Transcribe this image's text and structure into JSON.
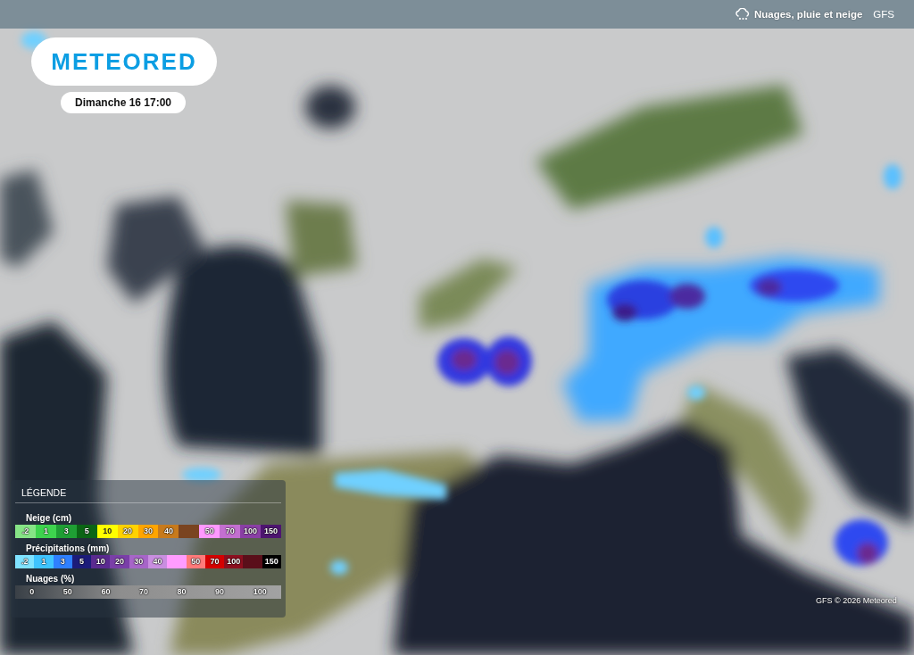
{
  "top_bar": {
    "layer": "Nuages, pluie et neige",
    "model": "GFS"
  },
  "logo": {
    "text": "METEORED"
  },
  "date": "Dimanche 16 17:00",
  "legend": {
    "title": "LÉGENDE",
    "scales": [
      {
        "title": "Neige (cm)",
        "kind": "steps",
        "steps": [
          {
            "label": ".2",
            "color": "#86e486"
          },
          {
            "label": "1",
            "color": "#3ed34e"
          },
          {
            "label": "3",
            "color": "#1f9e34"
          },
          {
            "label": "5",
            "color": "#0b6515"
          },
          {
            "label": "10",
            "color": "#ffff00"
          },
          {
            "label": "20",
            "color": "#ffd200"
          },
          {
            "label": "30",
            "color": "#ffa500"
          },
          {
            "label": "40",
            "color": "#c77a1c"
          },
          {
            "color": "#7a4420"
          },
          {
            "label": "50",
            "color": "#ff99ff"
          },
          {
            "label": "70",
            "color": "#c36fd0"
          },
          {
            "label": "100",
            "color": "#8a3fa5"
          },
          {
            "label": "150",
            "color": "#4e1570"
          }
        ]
      },
      {
        "title": "Précipitations (mm)",
        "kind": "steps",
        "steps": [
          {
            "label": ".2",
            "color": "#7fe3ff"
          },
          {
            "label": "1",
            "color": "#3fc4ff"
          },
          {
            "label": "3",
            "color": "#2f80ff"
          },
          {
            "label": "5",
            "color": "#1c1c7a"
          },
          {
            "label": "10",
            "color": "#5a2a90"
          },
          {
            "label": "20",
            "color": "#7a3fa8"
          },
          {
            "label": "30",
            "color": "#a765c8"
          },
          {
            "label": "40",
            "color": "#c98ee0"
          },
          {
            "color": "#ff9cff"
          },
          {
            "label": "50",
            "color": "#ff7a7a"
          },
          {
            "label": "70",
            "color": "#d40000"
          },
          {
            "label": "100",
            "color": "#8c0f1f"
          },
          {
            "color": "#5a0f1a"
          },
          {
            "label": "150",
            "color": "#000000"
          }
        ]
      },
      {
        "title": "Nuages (%)",
        "kind": "gradient",
        "ticks": [
          "0",
          "50",
          "60",
          "70",
          "80",
          "90",
          "100"
        ]
      }
    ]
  },
  "credit": "GFS © 2026 Meteored"
}
